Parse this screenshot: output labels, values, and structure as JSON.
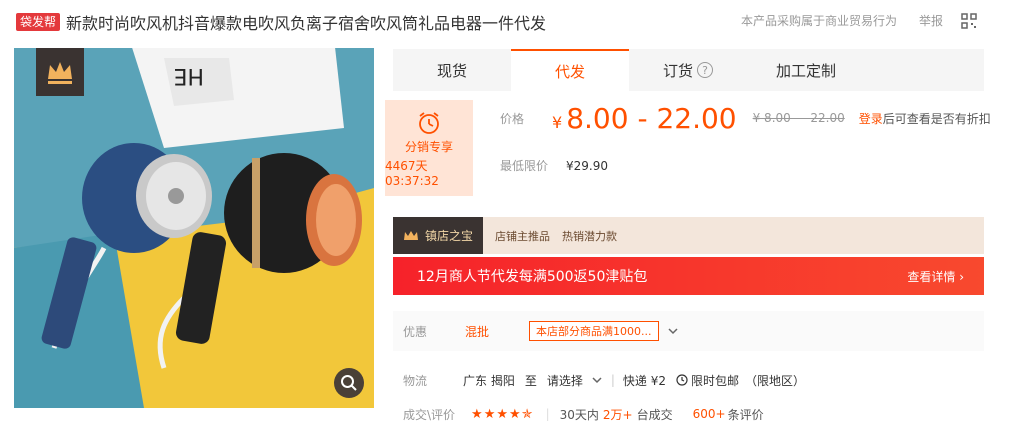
{
  "header": {
    "badge": "袋发帮",
    "title": "新款时尚吹风机抖音爆款电吹风负离子宿舍吹风筒礼品电器一件代发",
    "notice": "本产品采购属于商业贸易行为",
    "report": "举报"
  },
  "image": {
    "hair_dryer_text": "HE"
  },
  "tabs": [
    {
      "label": "现货"
    },
    {
      "label": "代发"
    },
    {
      "label": "订货"
    },
    {
      "label": "加工定制"
    }
  ],
  "promo_box": {
    "label": "分销专享",
    "timer": "4467天03:37:32"
  },
  "price": {
    "label": "价格",
    "currency": "¥",
    "range": "8.00 - 22.00",
    "old": "¥ 8.00 — 22.00",
    "login": "登录",
    "login_tail": "后可查看是否有折扣"
  },
  "min_price": {
    "label": "最低限价",
    "value": "¥29.90"
  },
  "shop_bar": {
    "badge": "镇店之宝",
    "tag1": "店铺主推品",
    "tag2": "热销潜力款"
  },
  "banner": {
    "text": "12月商人节代发每满500返50津贴包",
    "detail": "查看详情 ›"
  },
  "discount": {
    "label": "优惠",
    "mix": "混批",
    "coupon": "本店部分商品满1000..."
  },
  "logistics": {
    "label": "物流",
    "location": "广东 揭阳",
    "to": "至",
    "choose": "请选择",
    "express": "快递 ¥2",
    "timely": "限时包邮",
    "limited": "（限地区）"
  },
  "review": {
    "label": "成交\\评价",
    "stars": "★★★★✯",
    "days": "30天内",
    "count": "2万+",
    "deal": "台成交",
    "reviews": "600+",
    "reviews_tail": "条评价"
  },
  "colors": {
    "accent": "#ff5000",
    "banner_red": "#f6222a",
    "dark_badge": "#3a3331"
  }
}
